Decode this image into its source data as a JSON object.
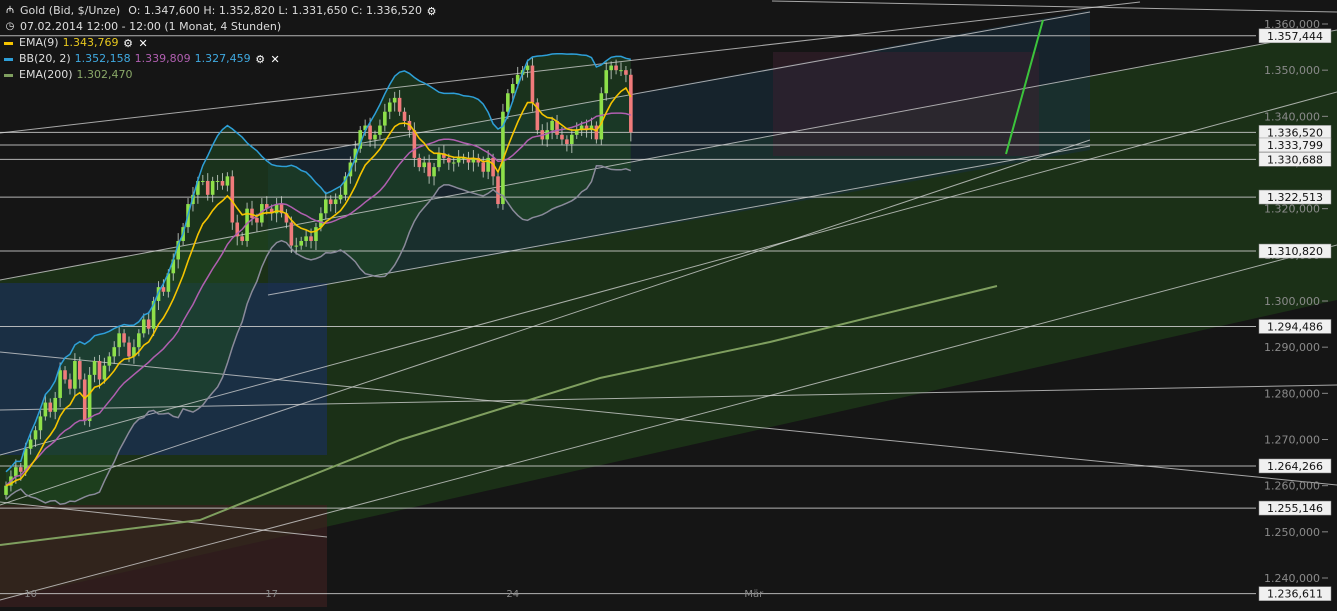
{
  "header": {
    "instrument": "Gold (Bid, $/Unze)",
    "ohlc": "O: 1.347,600  H: 1.352,820  L: 1.331,650  C: 1.336,520",
    "period": "07.02.2014 12:00 - 12:00 (1 Monat, 4 Stunden)"
  },
  "indicators": [
    {
      "name": "EMA(9)",
      "values": [
        "1.343,769"
      ],
      "value_colors": [
        "#e8c81e"
      ],
      "color": "#f5c400",
      "removable": true
    },
    {
      "name": "BB(20, 2)",
      "values": [
        "1.352,158",
        "1.339,809",
        "1.327,459"
      ],
      "value_colors": [
        "#3fa9e0",
        "#b05fb0",
        "#3fa9e0"
      ],
      "color": "#2e9fd8",
      "removable": true
    },
    {
      "name": "EMA(200)",
      "values": [
        "1.302,470"
      ],
      "value_colors": [
        "#8aa868"
      ],
      "color": "#7f9f5f",
      "removable": false
    }
  ],
  "colors": {
    "bull": "#8ee04a",
    "bear": "#f07b7b",
    "ema9": "#f5c400",
    "bb_outer": "#2e9fd8",
    "bb_mid": "#b05fb0",
    "ema200": "#6f8f4f",
    "bg": "#151515",
    "green_zone": "#1e3a16"
  },
  "chart_data": {
    "type": "line",
    "y_axis": {
      "range": [
        1234000,
        1363000
      ],
      "ticks": [
        "1.360,000",
        "1.350,000",
        "1.340,000",
        "1.330,000",
        "1.320,000",
        "1.310,000",
        "1.300,000",
        "1.290,000",
        "1.280,000",
        "1.270,000",
        "1.260,000",
        "1.250,000",
        "1.240,000"
      ],
      "tick_values": [
        1360000,
        1350000,
        1340000,
        1330000,
        1320000,
        1310000,
        1300000,
        1290000,
        1280000,
        1270000,
        1260000,
        1250000,
        1240000
      ],
      "side": "right",
      "grid": false
    },
    "x_axis": {
      "labels": [
        "10",
        "17",
        "24",
        "Mär"
      ],
      "label_index": [
        5,
        54,
        103,
        152
      ]
    },
    "horizontal_levels": [
      {
        "label": "1.357,444",
        "value": 1357444
      },
      {
        "label": "1.336,520",
        "value": 1336520
      },
      {
        "label": "1.333,799",
        "value": 1333799
      },
      {
        "label": "1.330,688",
        "value": 1330688
      },
      {
        "label": "1.322,513",
        "value": 1322513
      },
      {
        "label": "1.310,820",
        "value": 1310820
      },
      {
        "label": "1.294,486",
        "value": 1294486
      },
      {
        "label": "1.264,266",
        "value": 1264266
      },
      {
        "label": "1.255,146",
        "value": 1255146
      },
      {
        "label": "1.236,611",
        "value": 1236611
      }
    ],
    "current_price_label": "1.336,520",
    "candles_close": [
      1260000,
      1262000,
      1264000,
      1263000,
      1268000,
      1270000,
      1272000,
      1275000,
      1278000,
      1276000,
      1279000,
      1285000,
      1283000,
      1281000,
      1287000,
      1283000,
      1274000,
      1284000,
      1287000,
      1283000,
      1286000,
      1288000,
      1290000,
      1293000,
      1291000,
      1288000,
      1290000,
      1293000,
      1296000,
      1294000,
      1300000,
      1303000,
      1302000,
      1306000,
      1309000,
      1313000,
      1316000,
      1321000,
      1323000,
      1326000,
      1326000,
      1323000,
      1326000,
      1326000,
      1325000,
      1327000,
      1317000,
      1314000,
      1313000,
      1320000,
      1318000,
      1317000,
      1321000,
      1320000,
      1319000,
      1321000,
      1319000,
      1317000,
      1312000,
      1312000,
      1313000,
      1314000,
      1313000,
      1316000,
      1319000,
      1322000,
      1321000,
      1322000,
      1323000,
      1327000,
      1330000,
      1333000,
      1337000,
      1338000,
      1335000,
      1336000,
      1338000,
      1341000,
      1343000,
      1344000,
      1341000,
      1339000,
      1337000,
      1331000,
      1329000,
      1330000,
      1327000,
      1329000,
      1332000,
      1331000,
      1330000,
      1330000,
      1331000,
      1331000,
      1330000,
      1331000,
      1330000,
      1328000,
      1331000,
      1327000,
      1321000,
      1341000,
      1345000,
      1347000,
      1349000,
      1350000,
      1351000,
      1343000,
      1337000,
      1335000,
      1337000,
      1339000,
      1336000,
      1335000,
      1334000,
      1336000,
      1337000,
      1338000,
      1337000,
      1338000,
      1335000,
      1345000,
      1350000,
      1351000,
      1350000,
      1350000,
      1349000,
      1336520
    ],
    "series": [
      {
        "name": "EMA(9)",
        "last": 1343769
      },
      {
        "name": "BB(20, 2)",
        "last_upper": 1352158,
        "last_mid": 1339809,
        "last_lower": 1327459
      },
      {
        "name": "EMA(200)",
        "last": 1302470
      }
    ]
  }
}
